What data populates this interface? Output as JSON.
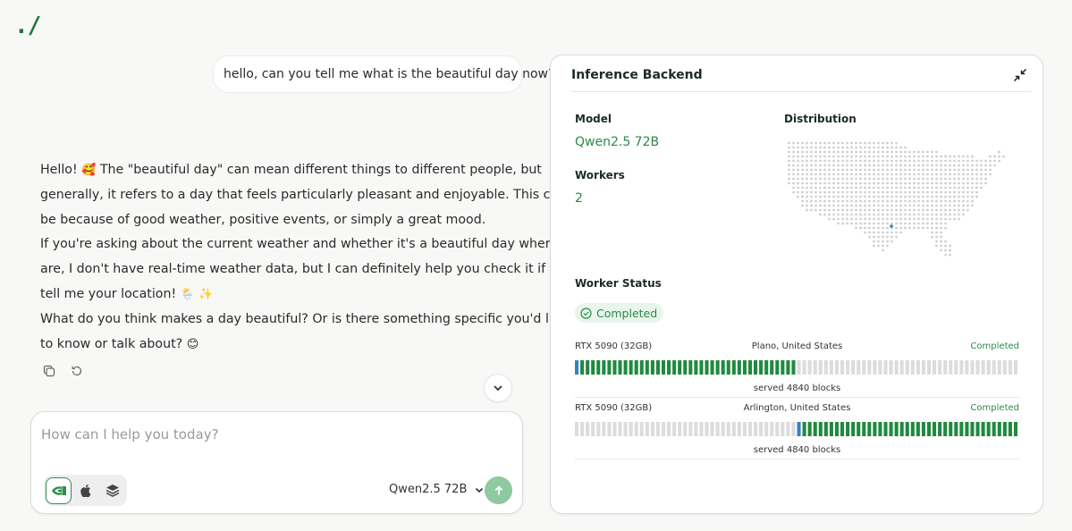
{
  "app": {
    "logo": "./"
  },
  "chat": {
    "user_message": "hello, can you tell me what is the beautiful day now?",
    "assistant_lines": [
      {
        "text": "Hello! ",
        "emoji": "🥰",
        "after": " The \"beautiful day\" can mean different things to different people, but"
      },
      {
        "text": "generally, it refers to a day that feels particularly pleasant and enjoyable. This could"
      },
      {
        "text": "be because of good weather, positive events, or simply a great mood."
      },
      {
        "text": "If you're asking about the current weather and whether it's a beautiful day where you"
      },
      {
        "text": "are, I don't have real-time weather data, but I can definitely help you check it if you"
      },
      {
        "text": "tell me your location! ",
        "emoji": "🌦️ ✨"
      },
      {
        "text": "What do you think makes a day beautiful? Or is there something specific you'd like"
      },
      {
        "text": "to know or talk about? ",
        "emoji": "😊"
      }
    ]
  },
  "composer": {
    "placeholder": "How can I help you today?",
    "model": "Qwen2.5 72B"
  },
  "backend_panel": {
    "title": "Inference Backend",
    "model_label": "Model",
    "model_value": "Qwen2.5 72B",
    "workers_label": "Workers",
    "workers_value": "2",
    "distribution_label": "Distribution",
    "worker_status_label": "Worker Status",
    "status_pill": "Completed",
    "workers": [
      {
        "gpu": "RTX 5090 (32GB)",
        "location": "Plano, United States",
        "status": "Completed",
        "served": "served 4840 blocks",
        "range": [
          0.0,
          0.5
        ]
      },
      {
        "gpu": "RTX 5090 (32GB)",
        "location": "Arlington, United States",
        "status": "Completed",
        "served": "served 4840 blocks",
        "range": [
          0.5,
          1.0
        ]
      }
    ]
  },
  "colors": {
    "accent": "#2a8a47",
    "bar_green": "#1f8a3f",
    "bar_blue": "#3a7fc1",
    "bar_idle": "#dcdcdc"
  }
}
